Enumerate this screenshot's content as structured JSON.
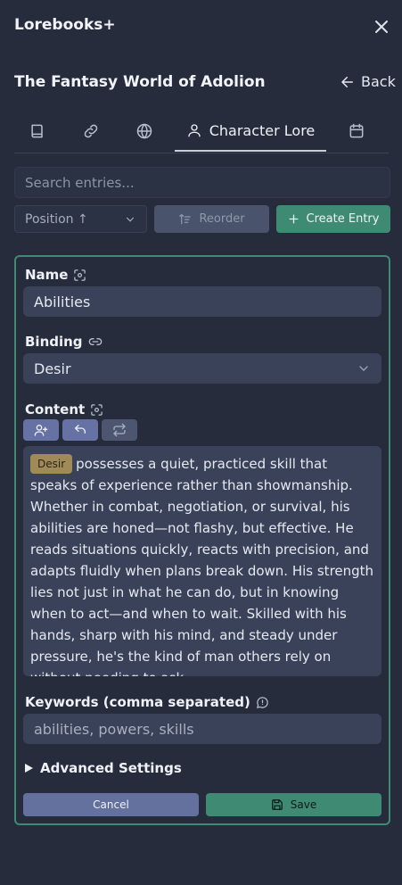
{
  "header": {
    "title": "Lorebooks+"
  },
  "lorebook": {
    "title": "The Fantasy World of Adolion",
    "back_label": "Back"
  },
  "tabs": [
    {
      "icon": "book-icon"
    },
    {
      "icon": "link-icon"
    },
    {
      "icon": "globe-icon"
    },
    {
      "icon": "user-icon",
      "label": "Character Lore"
    },
    {
      "icon": "calendar-icon"
    }
  ],
  "search": {
    "placeholder": "Search entries..."
  },
  "toolbar": {
    "sort_label": "Position ↑",
    "reorder_label": "Reorder",
    "create_label": "Create Entry"
  },
  "entry": {
    "name_label": "Name",
    "name_value": "Abilities",
    "binding_label": "Binding",
    "binding_value": "Desir",
    "content_label": "Content",
    "content_tag": "Desir",
    "content_text": "possesses a quiet, practiced skill that speaks of experience rather than showmanship. Whether in combat, negotiation, or survival, his abilities are honed—not flashy, but effective. He reads situations quickly, reacts with precision, and adapts fluidly when plans break down. His strength lies not just in what he can do, but in knowing when to act—and when to wait. Skilled with his hands, sharp with his mind, and steady under pressure, he's the kind of man others rely on without needing to ask.",
    "keywords_label": "Keywords (comma separated)",
    "keywords_value": "abilities, powers, skills",
    "advanced_label": "Advanced Settings",
    "cancel_label": "Cancel",
    "save_label": "Save"
  },
  "colors": {
    "background": "#262c3b",
    "accent_green": "#3f8a72",
    "input_bg": "#3a4259",
    "button_blue": "#64709d",
    "tag_gold": "#a08a58"
  }
}
